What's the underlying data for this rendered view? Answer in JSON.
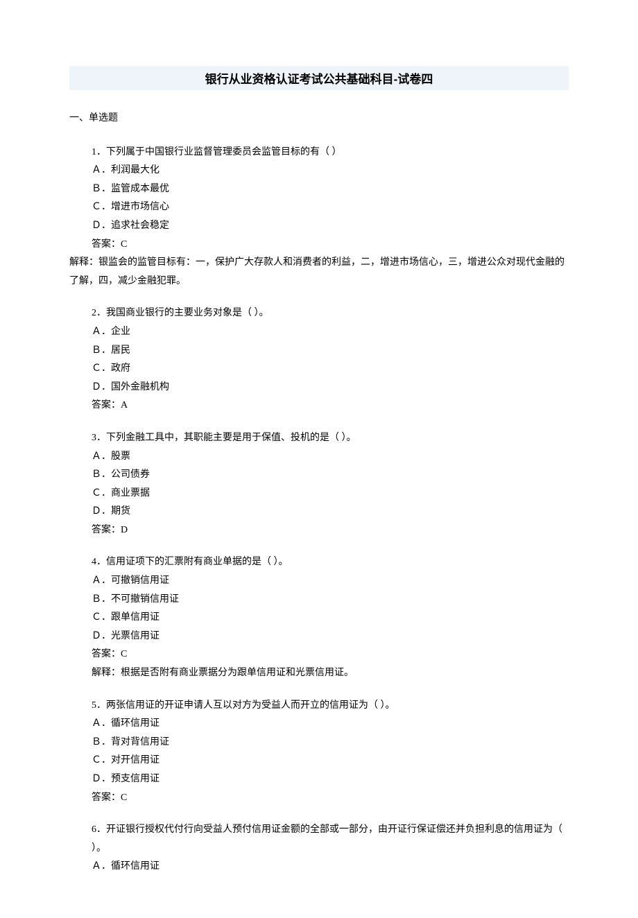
{
  "title": "银行从业资格认证考试公共基础科目-试卷四",
  "section": "一、单选题",
  "questions": [
    {
      "stem": "1．下列属于中国银行业监督管理委员会监管目标的有（  ）",
      "opts": [
        "Ａ．利润最大化",
        "Ｂ．监管成本最优",
        "Ｃ．增进市场信心",
        "Ｄ．追求社会稳定"
      ],
      "ans": "答案：C",
      "exp": "解释：银监会的监管目标有：一，保护广大存款人和消费者的利益，二，增进市场信心，三，增进公众对现代金融的了解，四，减少金融犯罪。"
    },
    {
      "stem": "2．我国商业银行的主要业务对象是（  ）。",
      "opts": [
        "Ａ．企业",
        "Ｂ．居民",
        "Ｃ．政府",
        "Ｄ．国外金融机构"
      ],
      "ans": "答案：A",
      "exp": ""
    },
    {
      "stem": "3．下列金融工具中，其职能主要是用于保值、投机的是（  ）。",
      "opts": [
        "Ａ．股票",
        "Ｂ．公司债券",
        "Ｃ．商业票据",
        "Ｄ．期货"
      ],
      "ans": "答案：D",
      "exp": ""
    },
    {
      "stem": "4．信用证项下的汇票附有商业单据的是（  ）。",
      "opts": [
        "Ａ．可撤销信用证",
        "Ｂ．不可撤销信用证",
        "Ｃ．跟单信用证",
        "Ｄ．光票信用证"
      ],
      "ans": "答案：C",
      "exp": "解释：根据是否附有商业票据分为跟单信用证和光票信用证。"
    },
    {
      "stem": "5．两张信用证的开证申请人互以对方为受益人而开立的信用证为（  ）。",
      "opts": [
        "Ａ．循环信用证",
        "Ｂ．背对背信用证",
        "Ｃ．对开信用证",
        "Ｄ．预支信用证"
      ],
      "ans": "答案：C",
      "exp": ""
    },
    {
      "stem": "6．开证银行授权代付行向受益人预付信用证金额的全部或一部分，由开证行保证偿还并负担利息的信用证为（  ）。",
      "opts": [
        "Ａ．循环信用证"
      ],
      "ans": "",
      "exp": ""
    }
  ]
}
